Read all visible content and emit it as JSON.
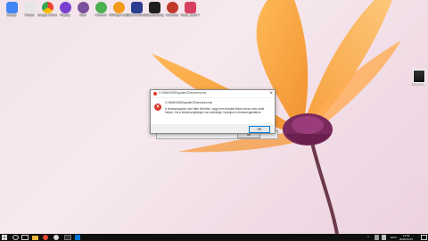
{
  "desktop_icons": [
    {
      "label": "Google",
      "icon": "google-drive-icon",
      "color": "#4285f4"
    },
    {
      "label": "Yandex",
      "icon": "yandex-icon",
      "color": "#e6e6e6"
    },
    {
      "label": "Google Chrome",
      "icon": "chrome-icon",
      "color": "#ea4335"
    },
    {
      "label": "Rikpiky",
      "icon": "browser-icon",
      "color": "#7a3fd0"
    },
    {
      "label": "Viber",
      "icon": "viber-icon",
      "color": "#7b519d"
    },
    {
      "label": "uTorrent",
      "icon": "utorrent-icon",
      "color": "#4caf50"
    },
    {
      "label": "KMPlayer Iosis Files",
      "icon": "kmplayer-icon",
      "color": "#f29b1d"
    },
    {
      "label": "Total Commander",
      "icon": "floppy-icon",
      "color": "#2c3e8f"
    },
    {
      "label": "4Kpersistency",
      "icon": "app-icon",
      "color": "#1e1e1e"
    },
    {
      "label": "CCleaner",
      "icon": "ccleaner-icon",
      "color": "#c0392b"
    },
    {
      "label": "Vkdol_v6.80.7",
      "icon": "app-icon",
      "color": "#d64161"
    }
  ],
  "right_icon": {
    "label": "Nitro PDF ...",
    "icon": "document-icon"
  },
  "dialog": {
    "title": "C:\\WINDOWS\\system32\\services.exe",
    "path": "C:\\WINDOWS\\system32\\services.exe",
    "message": "A rendszergazda nem tette lehetővé, vagy nem futtatott fiókra hozzá nem adott helyen. Ha a bírálat segítségre van szüksége, forduljon a rendszergazdához.",
    "ok_label": "OK"
  },
  "dialog2": {
    "ok_label": "OK"
  },
  "taskbar": {
    "tray_time": "11:52",
    "tray_date": "2019.04.01.",
    "tray_lang": "HUN"
  }
}
